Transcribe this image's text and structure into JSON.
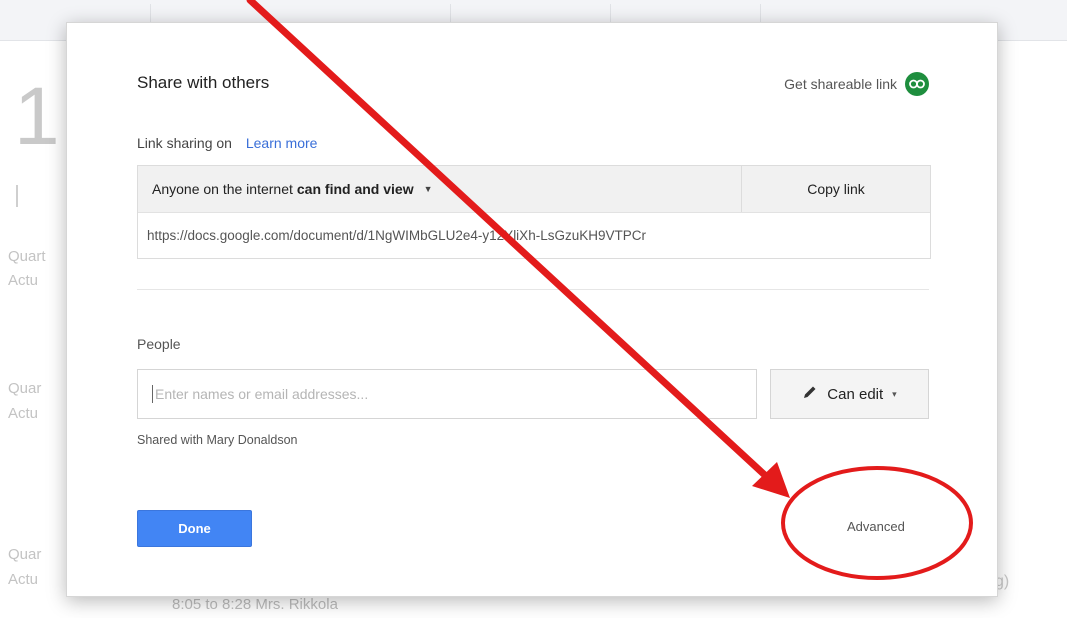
{
  "background": {
    "big_number": "1",
    "side_labels": [
      "Quart",
      "Actu",
      "Quar",
      "Actu",
      "Quar",
      "Actu"
    ],
    "right_fragment": "g)",
    "bottom_text": "8:05 to 8:28 Mrs. Rikkola"
  },
  "dialog": {
    "title": "Share with others",
    "get_link_label": "Get shareable link",
    "link_sharing_status": "Link sharing on",
    "learn_more": "Learn more",
    "access_prefix": "Anyone on the internet",
    "access_level": "can find and view",
    "copy_link_label": "Copy link",
    "link_url": "https://docs.google.com/document/d/1NgWIMbGLU2e4-y12YliXh-LsGzuKH9VTPCr",
    "people_label": "People",
    "people_placeholder": "Enter names or email addresses...",
    "permission_label": "Can edit",
    "shared_with": "Shared with Mary Donaldson",
    "done_label": "Done",
    "advanced_label": "Advanced"
  },
  "annotation": {
    "arrow_color": "#e31b1b",
    "circle_color": "#e31b1b"
  }
}
